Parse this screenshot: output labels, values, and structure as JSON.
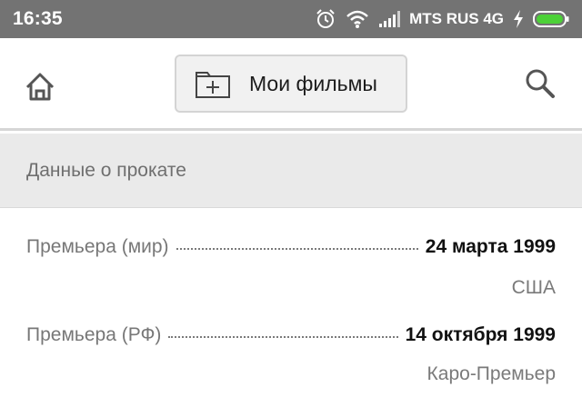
{
  "status_bar": {
    "time": "16:35",
    "carrier": "MTS RUS 4G",
    "icons": [
      "alarm-icon",
      "wifi-icon",
      "signal-icon",
      "charging-icon",
      "battery-icon"
    ],
    "battery_color": "#4cd137"
  },
  "toolbar": {
    "home_icon": "home-icon",
    "films_button_label": "Мои фильмы",
    "films_button_icon": "folder-plus-icon",
    "search_icon": "search-icon"
  },
  "section": {
    "title": "Данные о прокате"
  },
  "releases": [
    {
      "label": "Премьера (мир)",
      "value": "24 марта 1999",
      "sub": "США"
    },
    {
      "label": "Премьера (РФ)",
      "value": "14 октября 1999",
      "sub": "Каро-Премьер"
    }
  ]
}
